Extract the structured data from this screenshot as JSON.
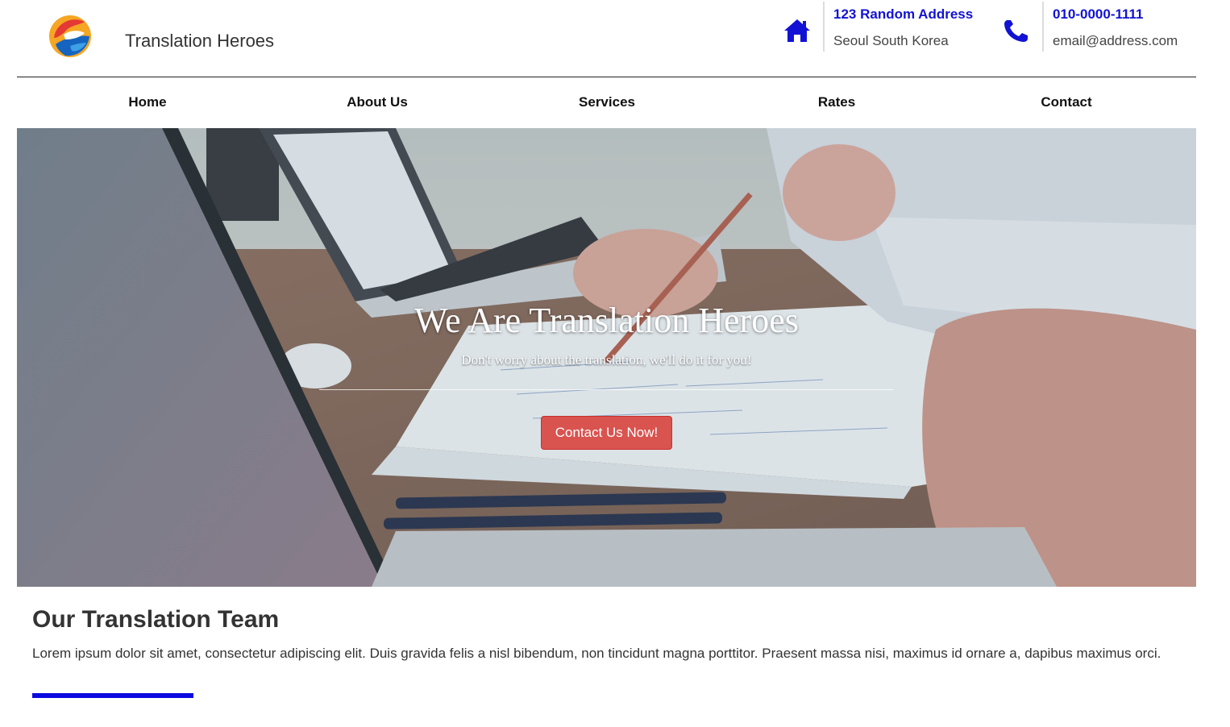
{
  "brand": {
    "name": "Translation Heroes",
    "logo_icon": "globe-logo-icon"
  },
  "contact": {
    "address": {
      "icon": "home-icon",
      "line1": "123 Random Address",
      "line2": "Seoul South Korea"
    },
    "phone": {
      "icon": "phone-icon",
      "line1": "010-0000-1111",
      "line2": "email@address.com"
    }
  },
  "nav": {
    "items": [
      {
        "label": "Home"
      },
      {
        "label": "About Us"
      },
      {
        "label": "Services"
      },
      {
        "label": "Rates"
      },
      {
        "label": "Contact"
      }
    ]
  },
  "hero": {
    "title": "We Are Translation Heroes",
    "subtitle": "Don't worry about the translation, we'll do it for you!",
    "cta_label": "Contact Us Now!"
  },
  "team": {
    "title": "Our Translation Team",
    "text": "Lorem ipsum dolor sit amet, consectetur adipiscing elit. Duis gravida felis a nisl bibendum, non tincidunt magna porttitor. Praesent massa nisi, maximus id ornare a, dapibus maximus orci."
  },
  "colors": {
    "accent": "#1212d4",
    "cta": "#d9534f",
    "underline": "#0a0ae0"
  }
}
